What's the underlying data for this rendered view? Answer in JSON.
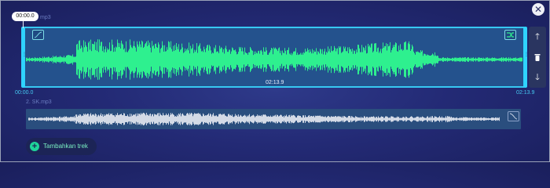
{
  "editor": {
    "close_icon": "close-icon",
    "playhead_time": "00:00.0"
  },
  "tracks": [
    {
      "name": "mp3",
      "duration_label": "02:13.9",
      "start_time": "00:00.0",
      "end_time": "02:13.9",
      "wave_color": "#2ef08f",
      "fade_in_icon": "fade-in-icon",
      "crossfade_icon": "crossfade-icon"
    },
    {
      "name": "2. SK.mp3",
      "wave_color": "#d3dae6",
      "fade_out_icon": "fade-out-icon"
    }
  ],
  "side_actions": [
    {
      "icon": "arrow-up-icon"
    },
    {
      "icon": "trash-icon"
    },
    {
      "icon": "arrow-down-icon"
    }
  ],
  "add_track": {
    "label": "Tambahkan trek",
    "icon": "plus-circle-icon"
  },
  "colors": {
    "accent": "#2fd3ff",
    "waveform": "#2ef08f",
    "add_label": "#7af0c2"
  }
}
